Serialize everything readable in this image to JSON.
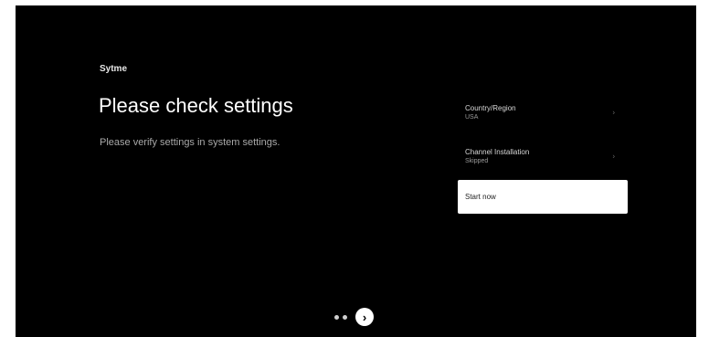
{
  "brand": "Sytme",
  "title": "Please check settings",
  "subtitle": "Please verify settings in system settings.",
  "menu": {
    "items": [
      {
        "label": "Country/Region",
        "value": "USA",
        "chevron": "chevron-right-icon"
      },
      {
        "label": "Channel Installation",
        "value": "Skipped",
        "chevron": "chevron-right-icon"
      },
      {
        "label": "Start now",
        "value": "",
        "chevron": ""
      }
    ]
  },
  "pager": {
    "dots": 2,
    "next_icon": "arrow-right-circle-icon",
    "next_glyph": "›"
  },
  "colors": {
    "background": "#000000",
    "focused_item": "#ffffff",
    "text_primary": "#ffffff",
    "text_secondary": "#a9a9a9"
  }
}
